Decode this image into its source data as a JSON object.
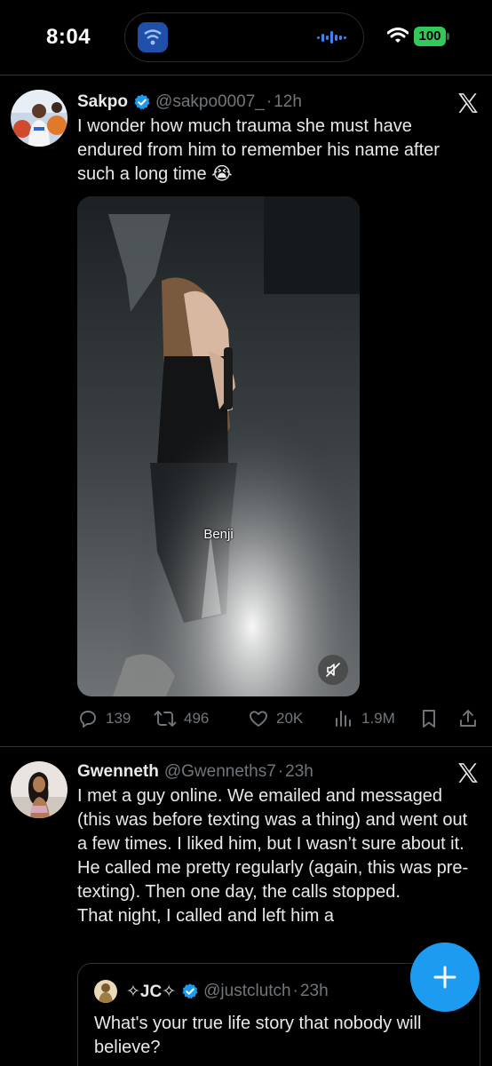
{
  "status_bar": {
    "time": "8:04",
    "battery": "100",
    "icons": [
      "island-app-icon",
      "audio-wave-icon",
      "wifi-icon",
      "battery-icon"
    ]
  },
  "tweet1": {
    "name": "Sakpo",
    "handle": "@sakpo0007_",
    "dot": "·",
    "time": "12h",
    "text": "I wonder how much trauma she must have endured from him to remember his name after such a long time 😭",
    "media": {
      "caption": "Benji",
      "video_progress": null
    },
    "actions": {
      "replies": "139",
      "reposts": "496",
      "likes": "20K",
      "views": "1.9M"
    }
  },
  "tweet2": {
    "name": "Gwenneth",
    "handle": "@Gwenneths7",
    "dot": "·",
    "time": "23h",
    "text_lines": [
      "I met a guy online. We emailed and messaged (this was before texting was a thing) and went out a few times. I liked him, but I wasn’t sure about it. He called me pretty regularly (again, this was pre-texting). Then one day, the calls stopped.",
      "That night, I called and left him a"
    ],
    "quote": {
      "name": "✧JC✧",
      "handle": "@justclutch",
      "dot": "·",
      "time": "23h",
      "text": "What's your true life story that nobody will believe?"
    }
  },
  "colors": {
    "background": "#000000",
    "text": "#e7e9ea",
    "muted": "#71767b",
    "accent": "#1d9bf0",
    "divider": "#2f3336",
    "battery": "#34c759"
  }
}
